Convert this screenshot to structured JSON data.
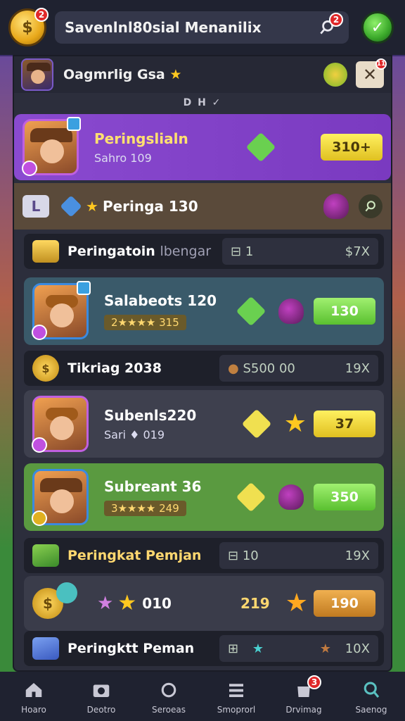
{
  "topbar": {
    "title": "Savenlnl80sial Menanilix",
    "coin_badge": "2",
    "search_badge": "2"
  },
  "panel": {
    "header_title": "Oagmrlig Gsa",
    "close_badge": "11",
    "subtab": "D H ✓"
  },
  "rows": [
    {
      "name": "Peringslialn",
      "sub": "Sahro 109",
      "value": "310+",
      "pill": "yellow"
    },
    {
      "name": "Peringa 130"
    },
    {
      "label": "Peringatoin",
      "label_dim": "lbengar",
      "stat_a": "1",
      "stat_b": "$7X"
    },
    {
      "name": "Salabeots 120",
      "sub": "2★★★★ 315",
      "value": "130",
      "pill": "green"
    },
    {
      "label": "Tikriag 2038",
      "stat_a": "S500 00",
      "stat_b": "19X"
    },
    {
      "name": "Subenls220",
      "sub": "Sari ♦ 019",
      "value": "37",
      "pill": "yellow"
    },
    {
      "name": "Subreant 36",
      "sub": "3★★★★ 249",
      "value": "350",
      "pill": "green"
    },
    {
      "label": "Peringkat Pemjan",
      "stat_a": "10",
      "stat_b": "19X"
    },
    {
      "name": "010",
      "sub": "219",
      "value": "190",
      "pill": "orange"
    },
    {
      "label": "Peringktt Peman",
      "stat_a": "10X"
    }
  ],
  "bottomnav": [
    {
      "label": "Hoaro",
      "icon": "home-icon"
    },
    {
      "label": "Deotro",
      "icon": "camera-icon"
    },
    {
      "label": "Seroeas",
      "icon": "refresh-icon"
    },
    {
      "label": "Smoprorl",
      "icon": "list-icon"
    },
    {
      "label": "Drvimag",
      "icon": "bag-icon",
      "badge": "3"
    },
    {
      "label": "Saenog",
      "icon": "search-icon"
    }
  ],
  "colors": {
    "accent_purple": "#8a4ad0",
    "accent_green": "#5aa040",
    "gold": "#ffc820"
  }
}
